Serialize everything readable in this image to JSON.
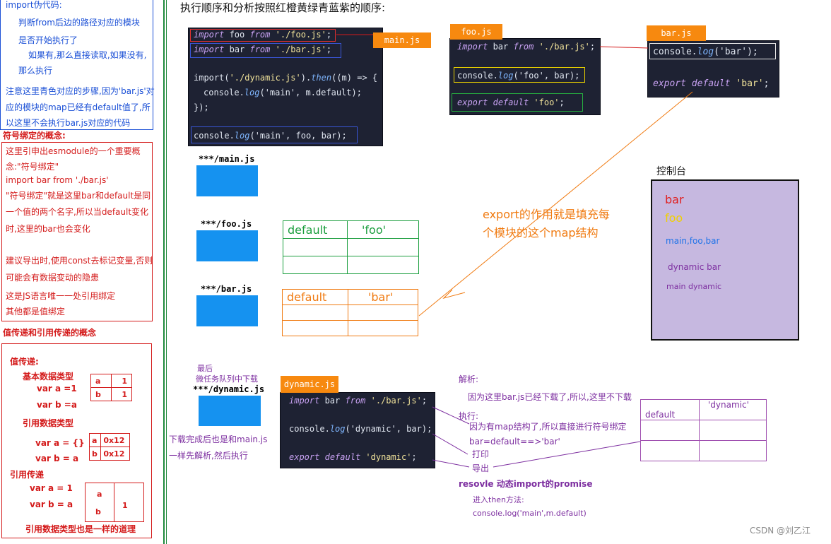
{
  "left": {
    "pseudo_title": "import伪代码:",
    "pseudo_lines": [
      "判断from后边的路径对应的模块",
      "是否开始执行了",
      "如果有,那么直接读取,如果没有,",
      "那么执行"
    ],
    "note_lines": [
      "注意这里青色对应的步骤,因为'bar.js'对",
      "应的模块的map已经有default值了,所",
      "以这里不会执行bar.js对应的代码"
    ],
    "binding_title": "符号绑定的概念:",
    "binding_lines": [
      "这里引申出esmodule的一个重要概",
      "念:\"符号绑定\"",
      "import bar from './bar.js'",
      "\"符号绑定\"就是这里bar和default是同",
      "一个值的两个名字,所以当default变化",
      "时,这里的bar也会变化"
    ],
    "advice_lines": [
      "建议导出时,使用const去标记变量,否则",
      "可能会有数据变动的隐患",
      "这是JS语言唯一一处引用绑定",
      "其他都是值绑定"
    ],
    "value_title": "值传递和引用传递的概念",
    "value": {
      "heading": "值传递:",
      "basic_type": "基本数据类型",
      "var_a1": "var a =1",
      "var_b1": "var b =a",
      "cells1": [
        [
          "a",
          "1"
        ],
        [
          "b",
          "1"
        ]
      ],
      "ref_type": "引用数据类型",
      "var_a2": "var a = {}",
      "var_b2": "var b = a",
      "cells2": [
        [
          "a",
          "0x12"
        ],
        [
          "b",
          "0x12"
        ]
      ],
      "ref_pass": "引用传递",
      "var_a3": "var a = 1",
      "var_b3": "var b = a",
      "cells3": [
        "a",
        "b",
        "1"
      ],
      "ref_same": "引用数据类型也是一样的道理"
    }
  },
  "main": {
    "title": "执行顺序和分析按照红橙黄绿青蓝紫的顺序:",
    "tags": {
      "main": "main.js",
      "foo": "foo.js",
      "bar": "bar.js",
      "dynamic": "dynamic.js"
    },
    "main_code": {
      "l1": [
        "import",
        " foo ",
        "from",
        " './foo.js'",
        ";"
      ],
      "l2": [
        "import",
        " bar ",
        "from",
        " './bar.js'",
        ";"
      ],
      "l3": [
        "import(",
        "'./dynamic.js'",
        ").",
        "then",
        "((m) => {"
      ],
      "l4": [
        "console.",
        "log",
        "('main', m.default);"
      ],
      "l5": "});",
      "l6": [
        "console.",
        "log",
        "('main', foo, bar);"
      ]
    },
    "foo_code": {
      "l1": [
        "import",
        " bar ",
        "from",
        " './bar.js'",
        ";"
      ],
      "l2": [
        "console.",
        "log",
        "('foo', bar);"
      ],
      "l3": [
        "export",
        " ",
        "default",
        " 'foo'",
        ";"
      ]
    },
    "bar_code": {
      "l1": [
        "console.",
        "log",
        "('bar');"
      ],
      "l2": [
        "export",
        " ",
        "default",
        " 'bar'",
        ";"
      ]
    },
    "dynamic_code": {
      "l1": [
        "import",
        " bar ",
        "from",
        " './bar.js'",
        ";"
      ],
      "l2": [
        "console.",
        "log",
        "('dynamic', bar);"
      ],
      "l3": [
        "export",
        " ",
        "default",
        " 'dynamic'",
        ";"
      ]
    },
    "module_labels": {
      "main": "***/main.js",
      "foo": "***/foo.js",
      "bar": "***/bar.js",
      "dynamic": "***/dynamic.js"
    },
    "last_label": [
      "最后",
      "微任务队列中下载"
    ],
    "foo_map": {
      "key": "default",
      "value": "'foo'"
    },
    "bar_map": {
      "key": "default",
      "value": "'bar'"
    },
    "export_note": [
      "export的作用就是填充每",
      "个模块的这个map结构"
    ],
    "console": {
      "title": "控制台",
      "lines": [
        "bar",
        "foo",
        "main,foo,bar",
        "dynamic bar",
        "main dynamic"
      ]
    },
    "download_note": [
      "下载完成后也是和main.js",
      "一样先解析,然后执行"
    ],
    "analysis": {
      "title": "解析:",
      "l1": "因为这里bar.js已经下载了,所以,这里不下载",
      "exec": "执行:",
      "l2": "因为有map结构了,所以直接进行符号绑定",
      "l3": "bar=default==>'bar'",
      "l4": "打印",
      "l5": "导出",
      "resolve": "resovle 动态import的promise",
      "then": "进入then方法:",
      "log": "console.log('main',m.default)"
    },
    "dyn_map": {
      "key": "default",
      "value": "'dynamic'"
    },
    "watermark": "CSDN @刘乙江"
  },
  "colors": {
    "red": "#d41b1b",
    "orange": "#f7890f",
    "yellow": "#f0d000",
    "green": "#1b9e3e",
    "cyan": "#12b0c8",
    "blue": "#2b6fe0",
    "purple": "#7d2fa0"
  }
}
